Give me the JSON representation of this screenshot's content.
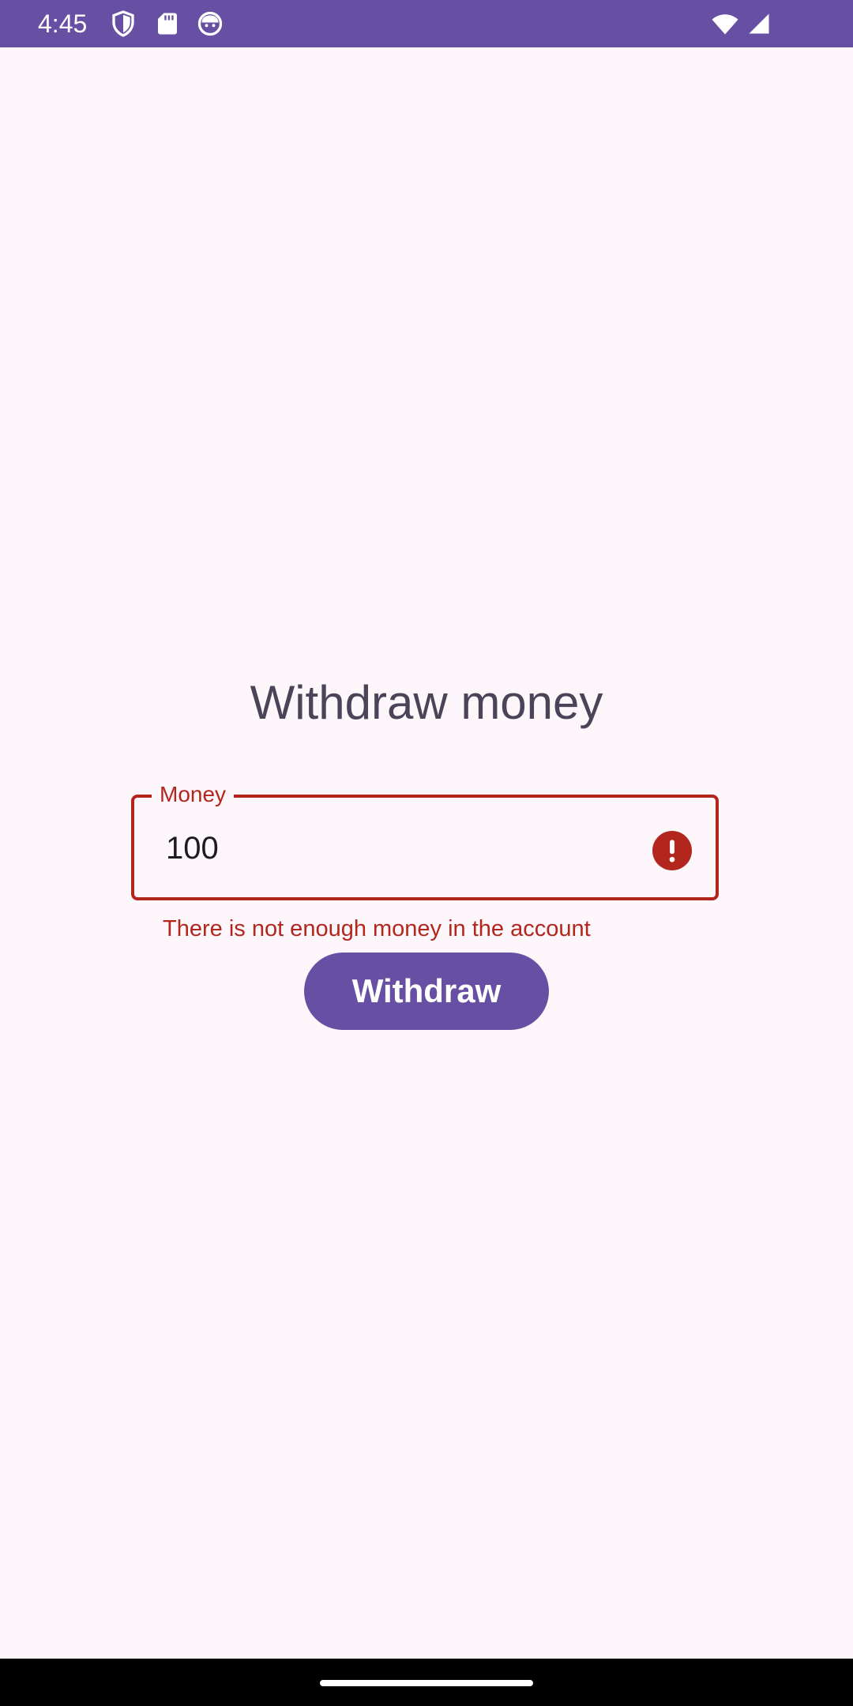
{
  "status_bar": {
    "time": "4:45",
    "icons": [
      "shield-icon",
      "sd-card-icon",
      "face-icon",
      "wifi-icon",
      "signal-icon"
    ],
    "background": "#6750a4"
  },
  "main": {
    "title": "Withdraw money",
    "money_field": {
      "label": "Money",
      "value": "100",
      "error_message": "There is not enough money in the account",
      "error_color": "#b3261e",
      "icon": "error-icon"
    },
    "withdraw_button": {
      "label": "Withdraw",
      "color": "#6750a4"
    }
  },
  "nav_bar": {
    "handle": "home-handle"
  }
}
